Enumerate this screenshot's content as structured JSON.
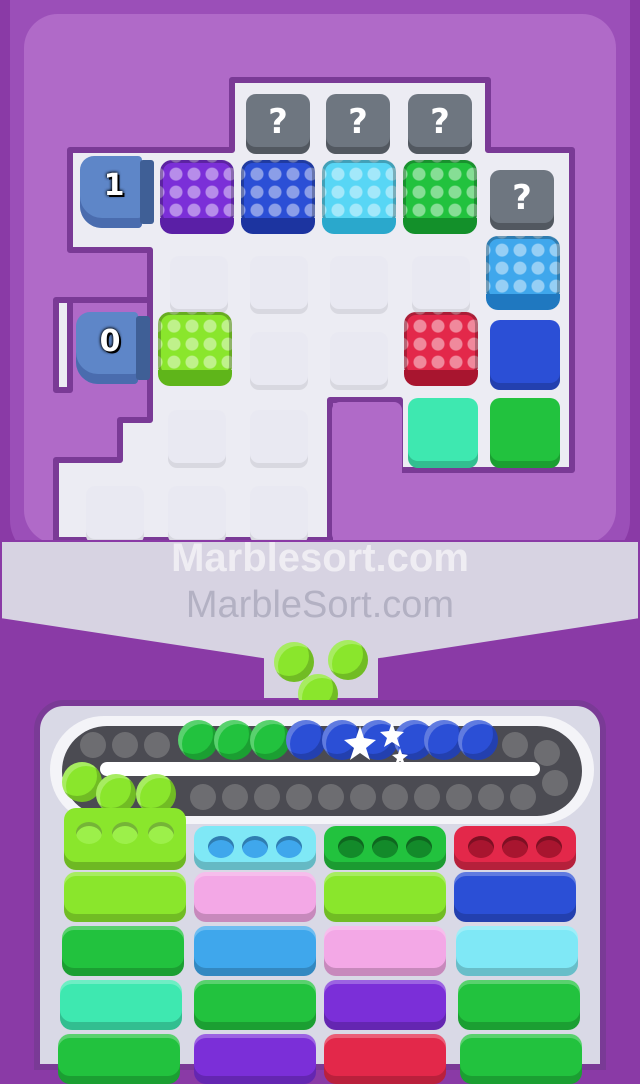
{
  "colors": {
    "frame": "#8a3aa6",
    "board": "#a35cbf",
    "tray": "#d9d9e6",
    "purple": "#7b2fd8",
    "blue": "#2b4fd6",
    "cyan": "#58d6f5",
    "green": "#22c23e",
    "lime": "#8ae62c",
    "red": "#e3284a",
    "mint": "#3ee8b0",
    "pink": "#f3a8e6",
    "skyblue": "#3fa7ec",
    "aqua": "#7fe8f6",
    "gray_q": "#6e7680"
  },
  "dispensers": [
    {
      "count": "1"
    },
    {
      "count": "0"
    }
  ],
  "mystery_label": "?",
  "watermarks": {
    "primary": "Marblesort.com",
    "secondary": "MarbleSort.com"
  },
  "marble_queue": {
    "falling": [
      "lime",
      "lime",
      "lime"
    ],
    "track": [
      "green",
      "green",
      "green",
      "blue",
      "blue",
      "blue",
      "blue",
      "blue",
      "blue"
    ]
  },
  "tubes": [
    {
      "cap": "lime",
      "segments": [
        "lime",
        "green",
        "mint",
        "green"
      ]
    },
    {
      "cap": "aqua",
      "segments": [
        "pink",
        "skyblue",
        "green",
        "purple"
      ]
    },
    {
      "cap": "green",
      "segments": [
        "lime",
        "pink",
        "purple",
        "red"
      ]
    },
    {
      "cap": "red",
      "segments": [
        "blue",
        "aqua",
        "green",
        "green"
      ]
    }
  ]
}
